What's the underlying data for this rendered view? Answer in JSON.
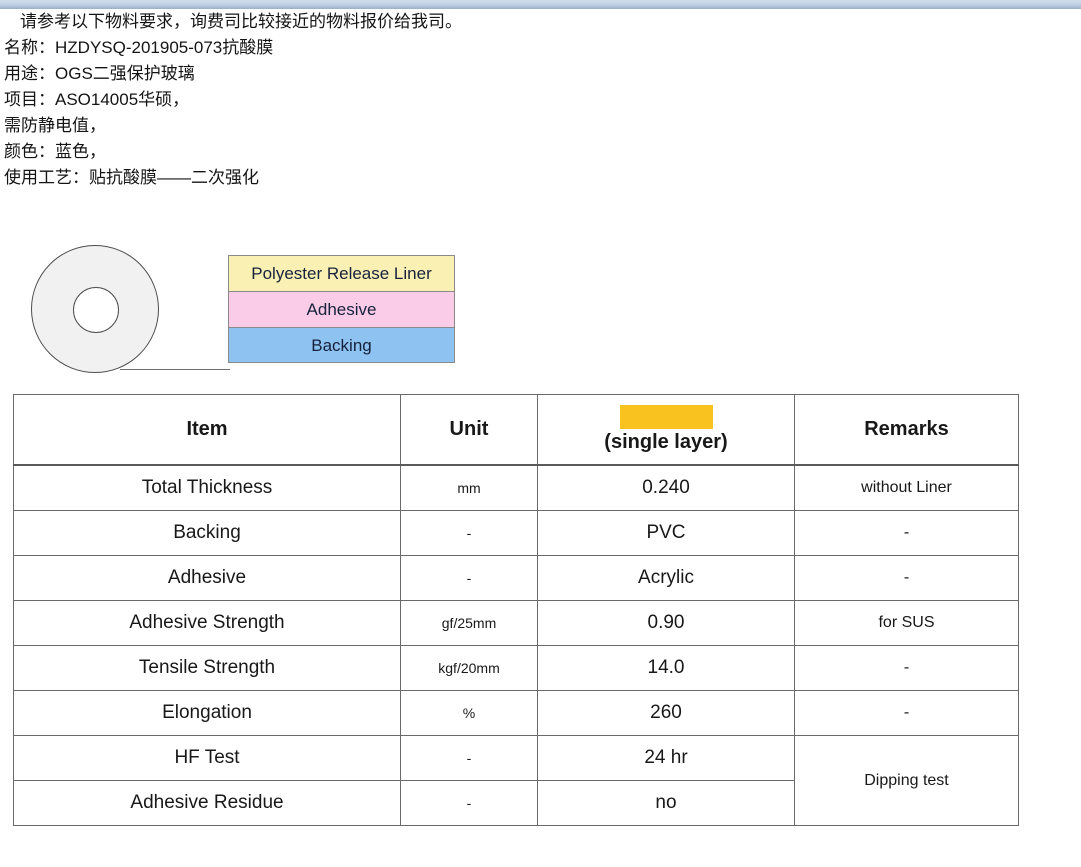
{
  "spec_notes": {
    "lines": [
      "请参考以下物料要求，询费司比较接近的物料报价给我司。",
      "名称：HZDYSQ-201905-073抗酸膜",
      "用途：OGS二强保护玻璃",
      "项目：ASO14005华硕，",
      "需防静电值，",
      "颜色：蓝色，",
      "使用工艺：贴抗酸膜——二次强化"
    ]
  },
  "diagram": {
    "roll_label": "tape-roll",
    "layers": [
      {
        "name": "Polyester Release Liner",
        "color": "#faf0b4"
      },
      {
        "name": "Adhesive",
        "color": "#fbcce8"
      },
      {
        "name": "Backing",
        "color": "#8ec2f0"
      }
    ]
  },
  "table": {
    "headers": {
      "item": "Item",
      "unit": "Unit",
      "value_redaction_color": "#f9c21f",
      "value_sub": "(single layer)",
      "remarks": "Remarks"
    },
    "rows": [
      {
        "item": "Total Thickness",
        "unit": "mm",
        "value": "0.240",
        "remark": "without Liner"
      },
      {
        "item": "Backing",
        "unit": "-",
        "value": "PVC",
        "remark": "-"
      },
      {
        "item": "Adhesive",
        "unit": "-",
        "value": "Acrylic",
        "remark": "-"
      },
      {
        "item": "Adhesive Strength",
        "unit": "gf/25mm",
        "value": "0.90",
        "remark": "for SUS"
      },
      {
        "item": "Tensile Strength",
        "unit": "kgf/20mm",
        "value": "14.0",
        "remark": "-"
      },
      {
        "item": "Elongation",
        "unit": "%",
        "value": "260",
        "remark": "-"
      },
      {
        "item": "HF Test",
        "unit": "-",
        "value": "24 hr",
        "remark": "Dipping test"
      },
      {
        "item": "Adhesive Residue",
        "unit": "-",
        "value": "no",
        "remark": ""
      }
    ]
  }
}
